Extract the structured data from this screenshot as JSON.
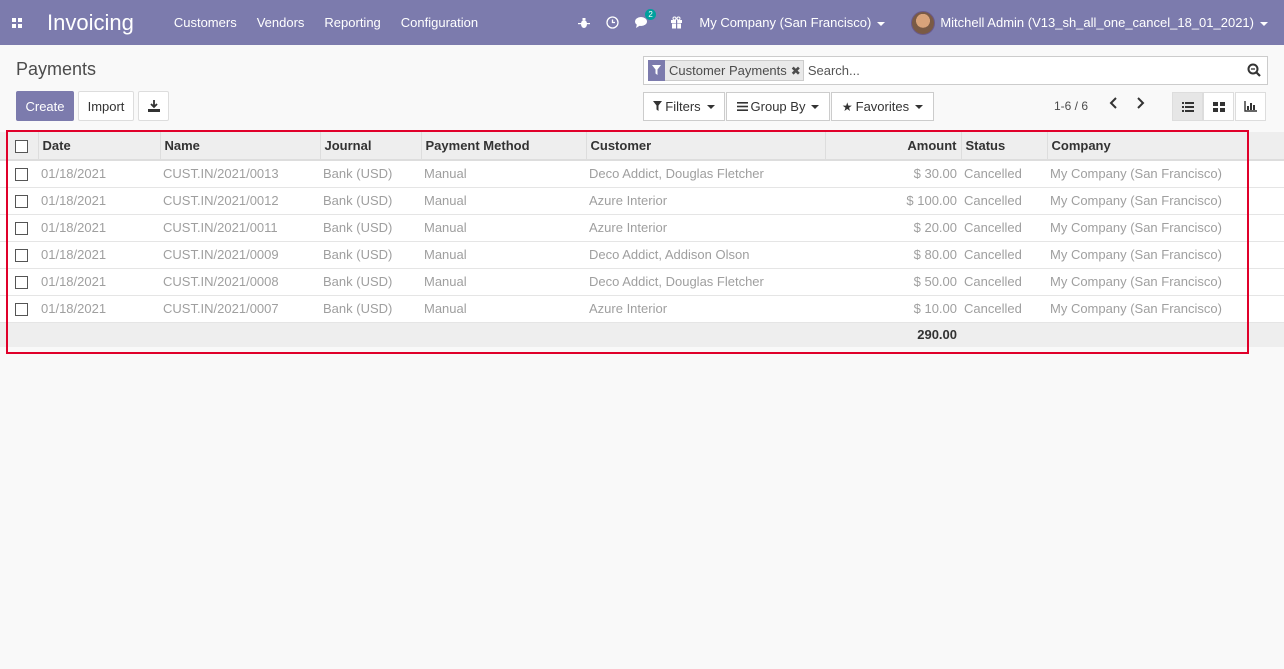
{
  "navbar": {
    "app_title": "Invoicing",
    "menu": [
      "Customers",
      "Vendors",
      "Reporting",
      "Configuration"
    ],
    "messages_count": "2",
    "company": "My Company (San Francisco)",
    "user": "Mitchell Admin (V13_sh_all_one_cancel_18_01_2021)"
  },
  "control_panel": {
    "breadcrumb": "Payments",
    "create_label": "Create",
    "import_label": "Import",
    "facet_label": "Customer Payments",
    "search_placeholder": "Search...",
    "filters_label": "Filters",
    "group_by_label": "Group By",
    "favorites_label": "Favorites",
    "pager": "1-6 / 6"
  },
  "table": {
    "columns": [
      "Date",
      "Name",
      "Journal",
      "Payment Method",
      "Customer",
      "Amount",
      "Status",
      "Company"
    ],
    "rows": [
      {
        "date": "01/18/2021",
        "name": "CUST.IN/2021/0013",
        "journal": "Bank (USD)",
        "method": "Manual",
        "customer": "Deco Addict, Douglas Fletcher",
        "amount": "$ 30.00",
        "status": "Cancelled",
        "company": "My Company (San Francisco)"
      },
      {
        "date": "01/18/2021",
        "name": "CUST.IN/2021/0012",
        "journal": "Bank (USD)",
        "method": "Manual",
        "customer": "Azure Interior",
        "amount": "$ 100.00",
        "status": "Cancelled",
        "company": "My Company (San Francisco)"
      },
      {
        "date": "01/18/2021",
        "name": "CUST.IN/2021/0011",
        "journal": "Bank (USD)",
        "method": "Manual",
        "customer": "Azure Interior",
        "amount": "$ 20.00",
        "status": "Cancelled",
        "company": "My Company (San Francisco)"
      },
      {
        "date": "01/18/2021",
        "name": "CUST.IN/2021/0009",
        "journal": "Bank (USD)",
        "method": "Manual",
        "customer": "Deco Addict, Addison Olson",
        "amount": "$ 80.00",
        "status": "Cancelled",
        "company": "My Company (San Francisco)"
      },
      {
        "date": "01/18/2021",
        "name": "CUST.IN/2021/0008",
        "journal": "Bank (USD)",
        "method": "Manual",
        "customer": "Deco Addict, Douglas Fletcher",
        "amount": "$ 50.00",
        "status": "Cancelled",
        "company": "My Company (San Francisco)"
      },
      {
        "date": "01/18/2021",
        "name": "CUST.IN/2021/0007",
        "journal": "Bank (USD)",
        "method": "Manual",
        "customer": "Azure Interior",
        "amount": "$ 10.00",
        "status": "Cancelled",
        "company": "My Company (San Francisco)"
      }
    ],
    "total_amount": "290.00"
  },
  "colors": {
    "brand": "#7c7bad",
    "highlight": "#e0002a"
  }
}
